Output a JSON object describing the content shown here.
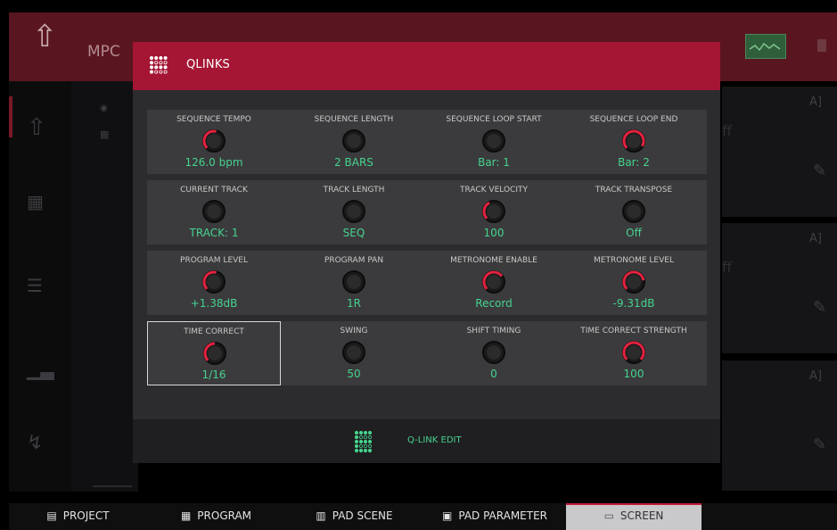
{
  "header": {
    "title": "MPC"
  },
  "modal": {
    "title": "QLINKS",
    "footer_button": "Q-LINK EDIT",
    "rows": [
      [
        {
          "label": "SEQUENCE TEMPO",
          "value": "126.0 bpm",
          "knob": "red",
          "level": 0.55
        },
        {
          "label": "SEQUENCE LENGTH",
          "value": "2 BARS",
          "knob": "dark",
          "level": 0
        },
        {
          "label": "SEQUENCE LOOP START",
          "value": "Bar: 1",
          "knob": "dark",
          "level": 0
        },
        {
          "label": "SEQUENCE LOOP END",
          "value": "Bar: 2",
          "knob": "red",
          "level": 0.95
        }
      ],
      [
        {
          "label": "CURRENT TRACK",
          "value": "TRACK: 1",
          "knob": "dark",
          "level": 0
        },
        {
          "label": "TRACK LENGTH",
          "value": "SEQ",
          "knob": "dark",
          "level": 0
        },
        {
          "label": "TRACK VELOCITY",
          "value": "100",
          "knob": "red",
          "level": 0.4
        },
        {
          "label": "TRACK TRANSPOSE",
          "value": "Off",
          "knob": "dark",
          "level": 0
        }
      ],
      [
        {
          "label": "PROGRAM LEVEL",
          "value": "+1.38dB",
          "knob": "red",
          "level": 0.55
        },
        {
          "label": "PROGRAM PAN",
          "value": "1R",
          "knob": "dark",
          "level": 0
        },
        {
          "label": "METRONOME ENABLE",
          "value": "Record",
          "knob": "red",
          "level": 0.7
        },
        {
          "label": "METRONOME LEVEL",
          "value": "-9.31dB",
          "knob": "red",
          "level": 0.8
        }
      ],
      [
        {
          "label": "TIME CORRECT",
          "value": "1/16",
          "knob": "red",
          "level": 0.5,
          "selected": true
        },
        {
          "label": "SWING",
          "value": "50",
          "knob": "dark",
          "level": 0
        },
        {
          "label": "SHIFT TIMING",
          "value": "0",
          "knob": "dark",
          "level": 0
        },
        {
          "label": "TIME CORRECT STRENGTH",
          "value": "100",
          "knob": "red",
          "level": 1.0
        }
      ]
    ]
  },
  "tabs": [
    {
      "label": "PROJECT",
      "icon": "document-icon"
    },
    {
      "label": "PROGRAM",
      "icon": "grid-icon"
    },
    {
      "label": "PAD SCENE",
      "icon": "pad-scene-icon"
    },
    {
      "label": "PAD PARAMETER",
      "icon": "pad-parameter-icon"
    },
    {
      "label": "SCREEN",
      "icon": "screen-icon",
      "active": true
    }
  ],
  "colors": {
    "accent": "#a51534",
    "value_green": "#46d38e",
    "knob_red": "#e4213f"
  }
}
